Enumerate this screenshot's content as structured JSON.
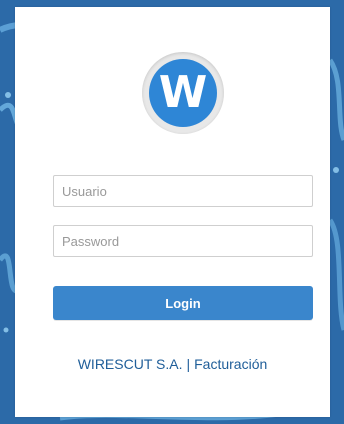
{
  "brand": {
    "logo_letter": "W",
    "accent_color": "#2e86d6"
  },
  "form": {
    "username_placeholder": "Usuario",
    "password_placeholder": "Password",
    "login_label": "Login"
  },
  "footer": {
    "company": "WIRESCUT S.A.",
    "separator": "|",
    "section": "Facturación"
  }
}
